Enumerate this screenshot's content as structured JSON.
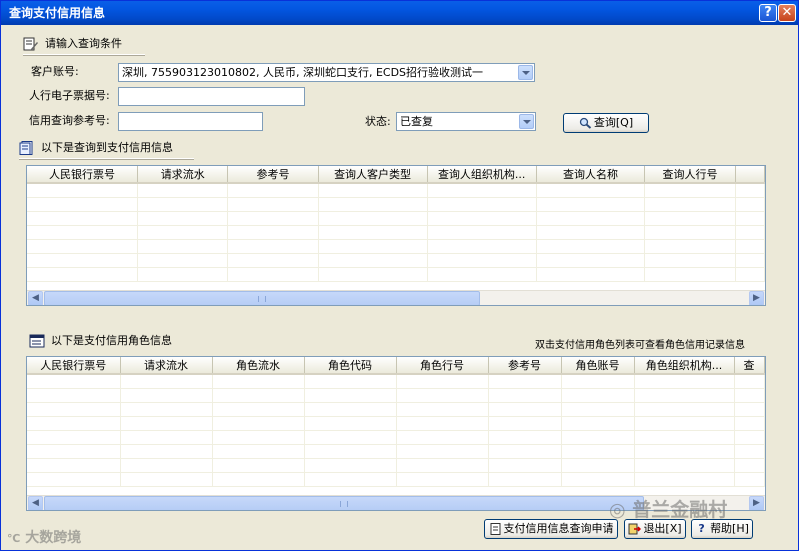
{
  "window": {
    "title": "查询支付信用信息",
    "help_glyph": "?",
    "close_glyph": "✕"
  },
  "query_section": {
    "header": "请输入查询条件",
    "icon": "edit-form-icon"
  },
  "fields": {
    "account_label": "客户账号:",
    "account_value": "深圳, 755903123010802, 人民币, 深圳蛇口支行, ECDS招行验收测试一",
    "ticket_label": "人行电子票据号:",
    "ticket_value": "",
    "ref_label": "信用查询参考号:",
    "ref_value": "",
    "status_label": "状态:",
    "status_value": "已查复"
  },
  "query_button": {
    "label": "查询[Q]",
    "icon": "magnifier-icon"
  },
  "results_section": {
    "header": "以下是查询到支付信用信息",
    "icon": "document-icon",
    "columns": [
      "人民银行票号",
      "请求流水",
      "参考号",
      "查询人客户类型",
      "查询人组织机构...",
      "查询人名称",
      "查询人行号"
    ]
  },
  "roles_section": {
    "header": "以下是支付信用角色信息",
    "icon": "window-icon",
    "hint": "双击支付信用角色列表可查看角色信用记录信息",
    "columns": [
      "人民银行票号",
      "请求流水",
      "角色流水",
      "角色代码",
      "角色行号",
      "参考号",
      "角色账号",
      "角色组织机构...",
      "查"
    ]
  },
  "footer_buttons": {
    "apply": "支付信用信息查询申请",
    "exit": "退出[X]",
    "help": "帮助[H]"
  },
  "watermarks": {
    "left": "大数跨境",
    "right": "普兰金融村"
  },
  "colors": {
    "titlebar": "#0356e0",
    "window_bg": "#ece9d8",
    "border": "#7f9db9"
  }
}
